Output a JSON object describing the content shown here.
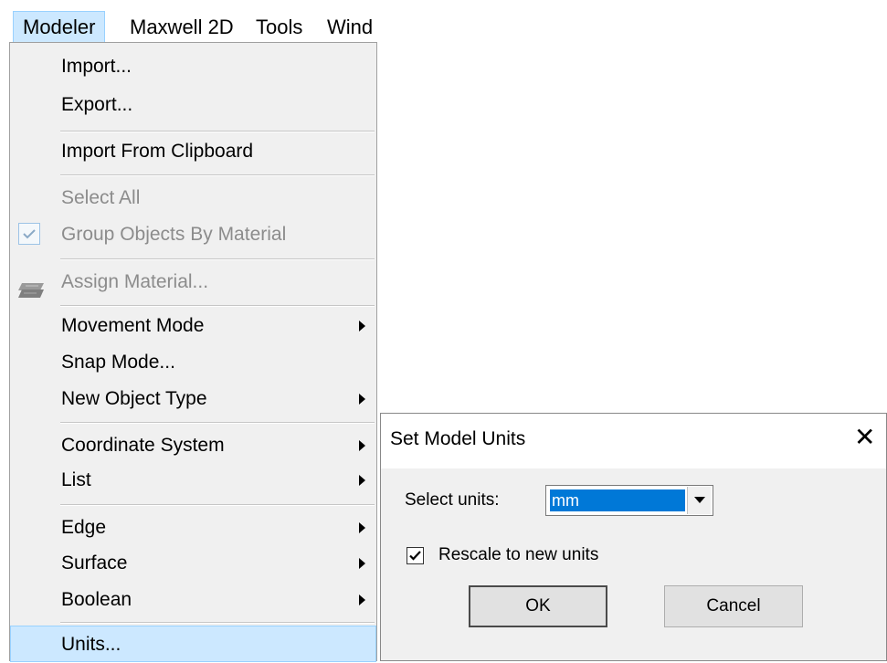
{
  "menubar": {
    "items": [
      "Modeler",
      "Maxwell 2D",
      "Tools",
      "Wind"
    ]
  },
  "menu": {
    "items": [
      {
        "label": "Import...",
        "enabled": true,
        "submenu": false
      },
      {
        "label": "Export...",
        "enabled": true,
        "submenu": false
      },
      {
        "label": "Import From Clipboard",
        "enabled": true,
        "submenu": false
      },
      {
        "label": "Select All",
        "enabled": false,
        "submenu": false
      },
      {
        "label": "Group Objects By Material",
        "enabled": false,
        "submenu": false,
        "checked": true
      },
      {
        "label": "Assign Material...",
        "enabled": false,
        "submenu": false,
        "icon": "material-icon"
      },
      {
        "label": "Movement Mode",
        "enabled": true,
        "submenu": true
      },
      {
        "label": "Snap Mode...",
        "enabled": true,
        "submenu": false
      },
      {
        "label": "New Object Type",
        "enabled": true,
        "submenu": true
      },
      {
        "label": "Coordinate System",
        "enabled": true,
        "submenu": true
      },
      {
        "label": "List",
        "enabled": true,
        "submenu": true
      },
      {
        "label": "Edge",
        "enabled": true,
        "submenu": true
      },
      {
        "label": "Surface",
        "enabled": true,
        "submenu": true
      },
      {
        "label": "Boolean",
        "enabled": true,
        "submenu": true
      },
      {
        "label": "Units...",
        "enabled": true,
        "submenu": false,
        "highlighted": true
      }
    ]
  },
  "dialog": {
    "title": "Set Model Units",
    "close_glyph": "✕",
    "select_label": "Select units:",
    "units_value": "mm",
    "rescale_label": "Rescale to new units",
    "rescale_checked": true,
    "ok_label": "OK",
    "cancel_label": "Cancel"
  },
  "colors": {
    "highlight_bg": "#cce8ff",
    "highlight_border": "#99d1ff",
    "selection_blue": "#0078d7",
    "disabled_text": "#8c8c8c"
  }
}
